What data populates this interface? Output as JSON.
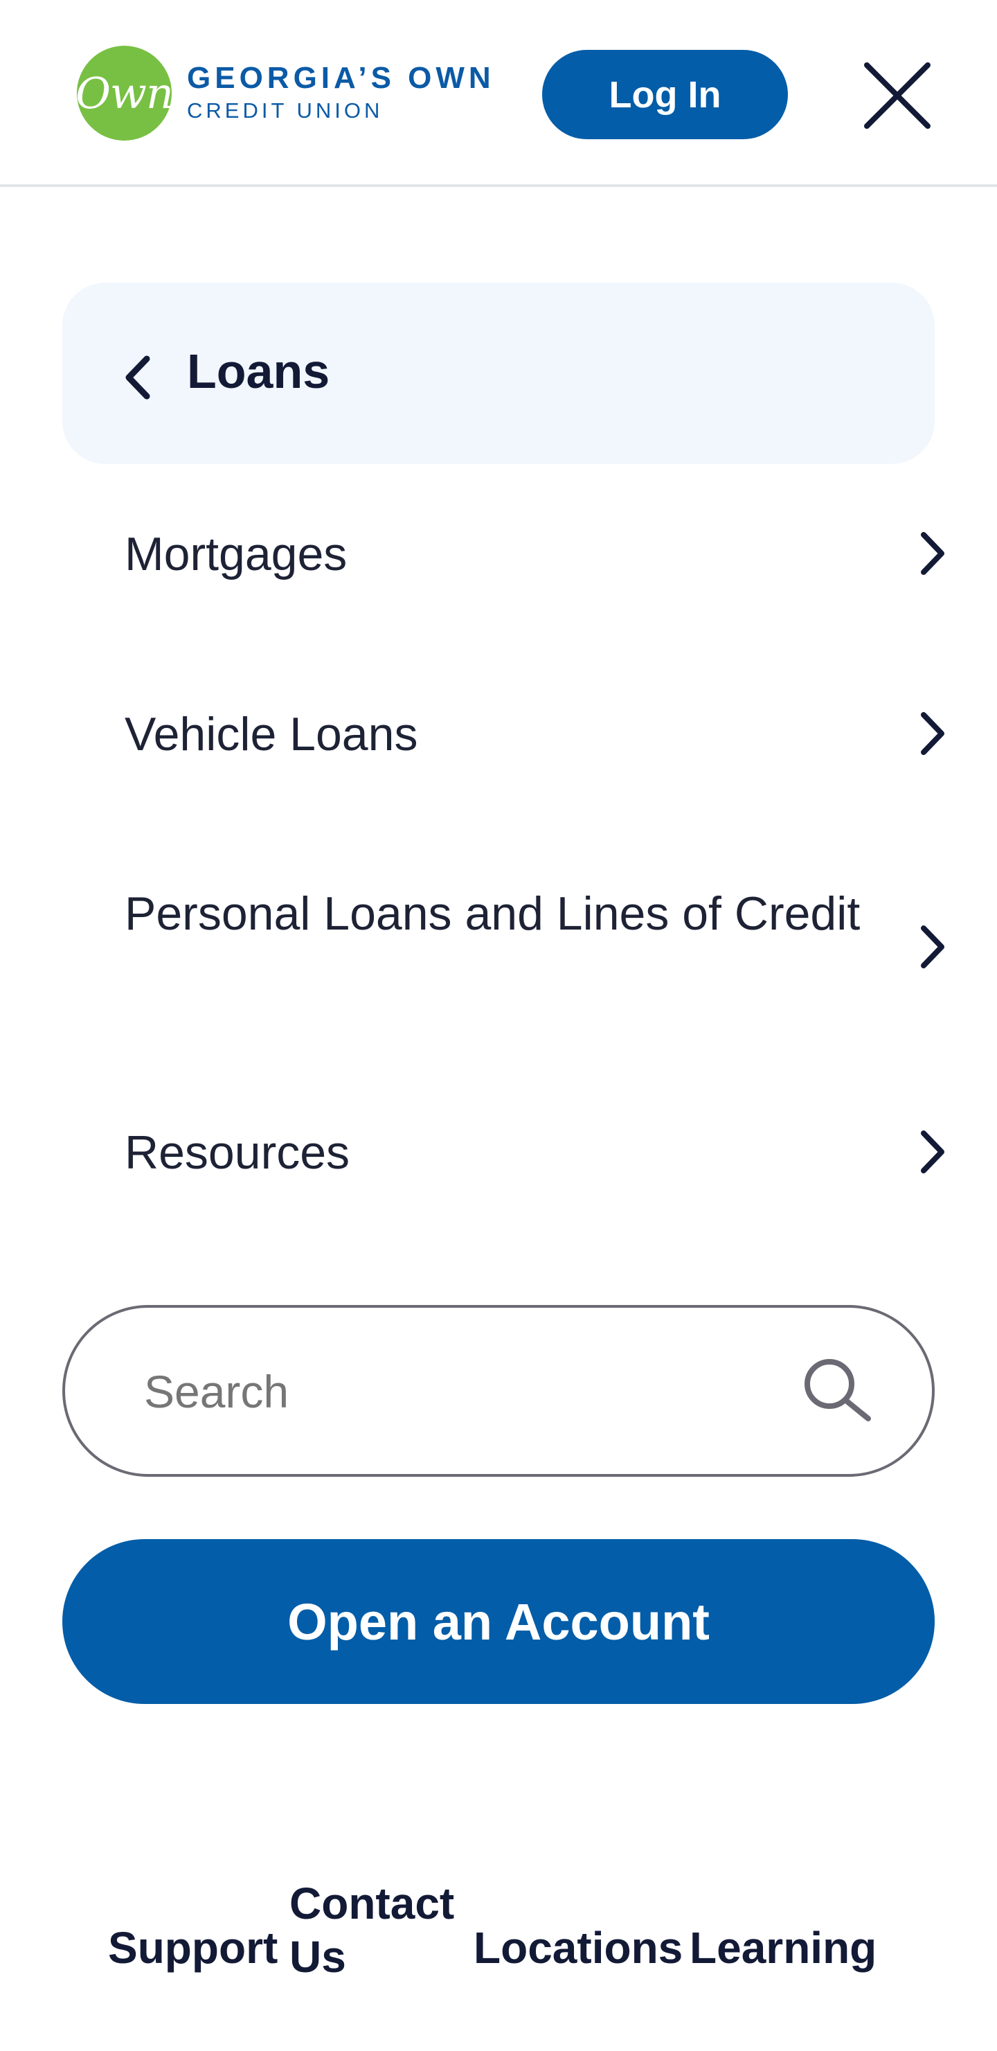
{
  "brand": {
    "mark_text": "Own",
    "name_line1": "GEORGIA’S OWN",
    "name_line2": "CREDIT UNION",
    "mark_color": "#78c043",
    "text_color": "#0b5aa6"
  },
  "header": {
    "login_label": "Log In",
    "close_icon": "close-icon"
  },
  "section": {
    "back_icon": "chevron-left-icon",
    "title": "Loans"
  },
  "menu": {
    "items": [
      {
        "label": "Mortgages",
        "icon": "chevron-right-icon"
      },
      {
        "label": "Vehicle Loans",
        "icon": "chevron-right-icon"
      },
      {
        "label": "Personal Loans and  Lines of Credit",
        "icon": "chevron-right-icon"
      },
      {
        "label": "Resources",
        "icon": "chevron-right-icon"
      }
    ]
  },
  "search": {
    "placeholder": "Search",
    "value": "",
    "icon": "search-icon"
  },
  "cta": {
    "open_account_label": "Open an Account"
  },
  "footer": {
    "links": [
      "Support",
      "Contact Us",
      "Locations",
      "Learning"
    ]
  },
  "colors": {
    "primary": "#035da8",
    "text_dark": "#131a36",
    "section_bg": "#f2f7fd",
    "border": "#6b6a74"
  }
}
